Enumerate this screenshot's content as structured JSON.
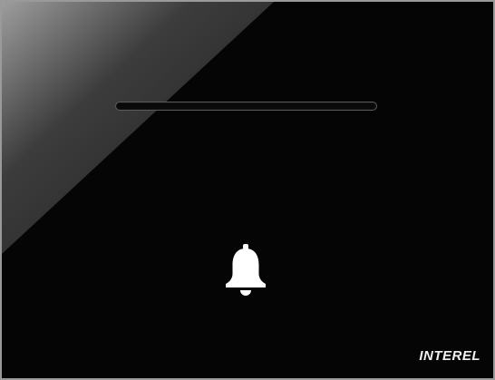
{
  "panel": {
    "brand": "INTEREL",
    "button_icon": "bell-icon",
    "colors": {
      "background": "#050505",
      "frame": "#9a9a9a",
      "icon": "#ffffff",
      "slot_outline": "#5b5b5b"
    }
  }
}
